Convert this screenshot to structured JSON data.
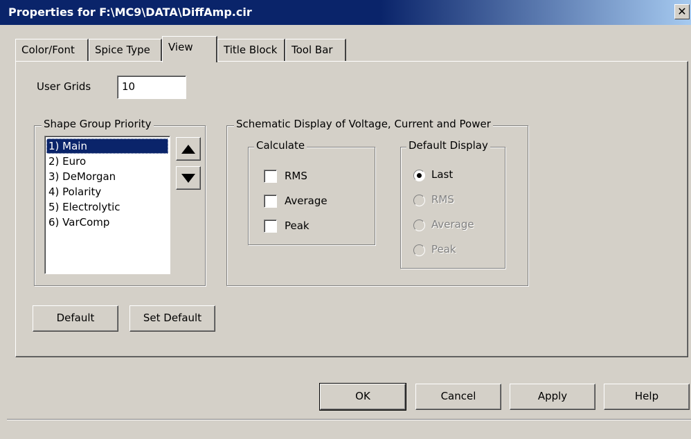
{
  "window": {
    "title": "Properties for F:\\MC9\\DATA\\DiffAmp.cir",
    "close_glyph": "✕"
  },
  "tabs": [
    {
      "label": "Color/Font"
    },
    {
      "label": "Spice Type"
    },
    {
      "label": "View"
    },
    {
      "label": "Title Block"
    },
    {
      "label": "Tool Bar"
    }
  ],
  "user_grids": {
    "label": "User Grids",
    "value": "10"
  },
  "shape_group": {
    "title": "Shape Group Priority",
    "items": [
      "1) Main",
      "2) Euro",
      "3) DeMorgan",
      "4) Polarity",
      "5) Electrolytic",
      "6) VarComp"
    ],
    "selected": "1) Main"
  },
  "schematic": {
    "title": "Schematic Display of Voltage, Current and Power",
    "calculate": {
      "title": "Calculate",
      "options": [
        "RMS",
        "Average",
        "Peak"
      ],
      "checked": []
    },
    "default_display": {
      "title": "Default Display",
      "options": [
        "Last",
        "RMS",
        "Average",
        "Peak"
      ],
      "selected": "Last"
    }
  },
  "buttons": {
    "default": "Default",
    "set_default": "Set Default",
    "ok": "OK",
    "cancel": "Cancel",
    "apply": "Apply",
    "help": "Help"
  },
  "colors": {
    "title_bar": "#0a246a",
    "face": "#d4d0c8",
    "selection": "#0a246a"
  }
}
